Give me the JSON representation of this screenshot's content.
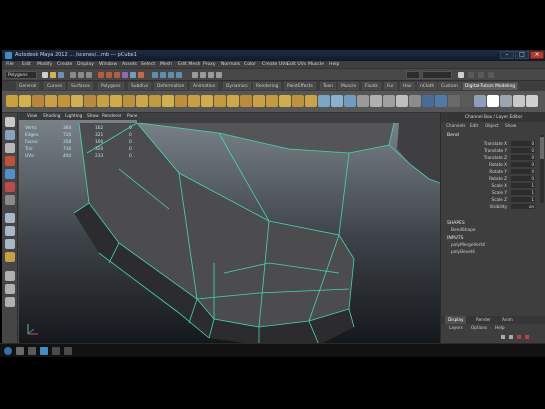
{
  "window": {
    "title": "Autodesk Maya 2012 ... /scenes/...mb --- pCube1"
  },
  "menubar": {
    "items": [
      "File",
      "Edit",
      "Modify",
      "Create",
      "Display",
      "Window",
      "Assets",
      "Select",
      "Mesh",
      "Edit Mesh",
      "Proxy",
      "Normals",
      "Color",
      "Create UVs",
      "Edit UVs",
      "Muscle",
      "Help"
    ]
  },
  "statusline": {
    "mode": "Polygons"
  },
  "shelf": {
    "tabs": [
      "General",
      "Curves",
      "Surfaces",
      "Polygons",
      "Subdivs",
      "Deformation",
      "Animation",
      "Dynamics",
      "Rendering",
      "PaintEffects",
      "Toon",
      "Muscle",
      "Fluids",
      "Fur",
      "Hair",
      "nCloth",
      "Custom",
      "Digital-Tutors Modeling"
    ],
    "active_tab": "Digital-Tutors Modeling",
    "icon_colors": [
      "#c9a23a",
      "#d6b24a",
      "#b8873a",
      "#caa045",
      "#c49436",
      "#d0b050",
      "#b98a3c",
      "#c8a040",
      "#d3aa44",
      "#bf903a",
      "#cda648",
      "#c29a3e",
      "#d4b04c",
      "#be8e3a",
      "#c79e42",
      "#d1ac4a",
      "#c5983c",
      "#cfa846",
      "#bb8c38",
      "#caa244",
      "#c39a40",
      "#d2ae4a",
      "#c0923c",
      "#cca446",
      "#7aa6c8",
      "#8ab0d0",
      "#6f9cc0",
      "#9a9a9a",
      "#b0b0b0",
      "#a0a0a0",
      "#c0c0c0",
      "#8c8c8c",
      "#4a6a9a",
      "#5078a8",
      "#6a6a6a",
      "#5a5a5a",
      "#8aa0b8",
      "#ffffff",
      "#9aa6b0",
      "#c8c8c8",
      "#d0d0d0"
    ]
  },
  "viewport": {
    "menu": [
      "View",
      "Shading",
      "Lighting",
      "Show",
      "Renderer",
      "Panels"
    ],
    "hud": [
      {
        "label": "Verts:",
        "v1": "364",
        "v2": "162",
        "v3": "0"
      },
      {
        "label": "Edges:",
        "v1": "720",
        "v2": "321",
        "v3": "0"
      },
      {
        "label": "Faces:",
        "v1": "358",
        "v2": "160",
        "v3": "0"
      },
      {
        "label": "Tris:",
        "v1": "716",
        "v2": "320",
        "v3": "0"
      },
      {
        "label": "UVs:",
        "v1": "494",
        "v2": "233",
        "v3": "0"
      }
    ]
  },
  "channelbox": {
    "title": "Channel Box / Layer Editor",
    "menu": [
      "Channels",
      "Edit",
      "Object",
      "Show"
    ],
    "object": "Bend",
    "attributes": [
      {
        "name": "Translate X",
        "value": "0"
      },
      {
        "name": "Translate Y",
        "value": "0"
      },
      {
        "name": "Translate Z",
        "value": "0"
      },
      {
        "name": "Rotate X",
        "value": "0"
      },
      {
        "name": "Rotate Y",
        "value": "0"
      },
      {
        "name": "Rotate Z",
        "value": "0"
      },
      {
        "name": "Scale X",
        "value": "1"
      },
      {
        "name": "Scale Y",
        "value": "1"
      },
      {
        "name": "Scale Z",
        "value": "1"
      },
      {
        "name": "Visibility",
        "value": "on"
      }
    ],
    "shapes_label": "SHAPES",
    "shapes": [
      "BendShape"
    ],
    "inputs_label": "INPUTS",
    "inputs": [
      "polyMergeVert4",
      "polyBevel4"
    ],
    "layer_tabs": [
      "Display",
      "Render",
      "Anim"
    ],
    "active_layer_tab": "Display",
    "layer_menu": [
      "Layers",
      "Options",
      "Help"
    ]
  },
  "colors": {
    "wireframe": "#3fd9b1",
    "mesh_fill": "#4a4a4c",
    "accent": "#2d6fa8"
  }
}
